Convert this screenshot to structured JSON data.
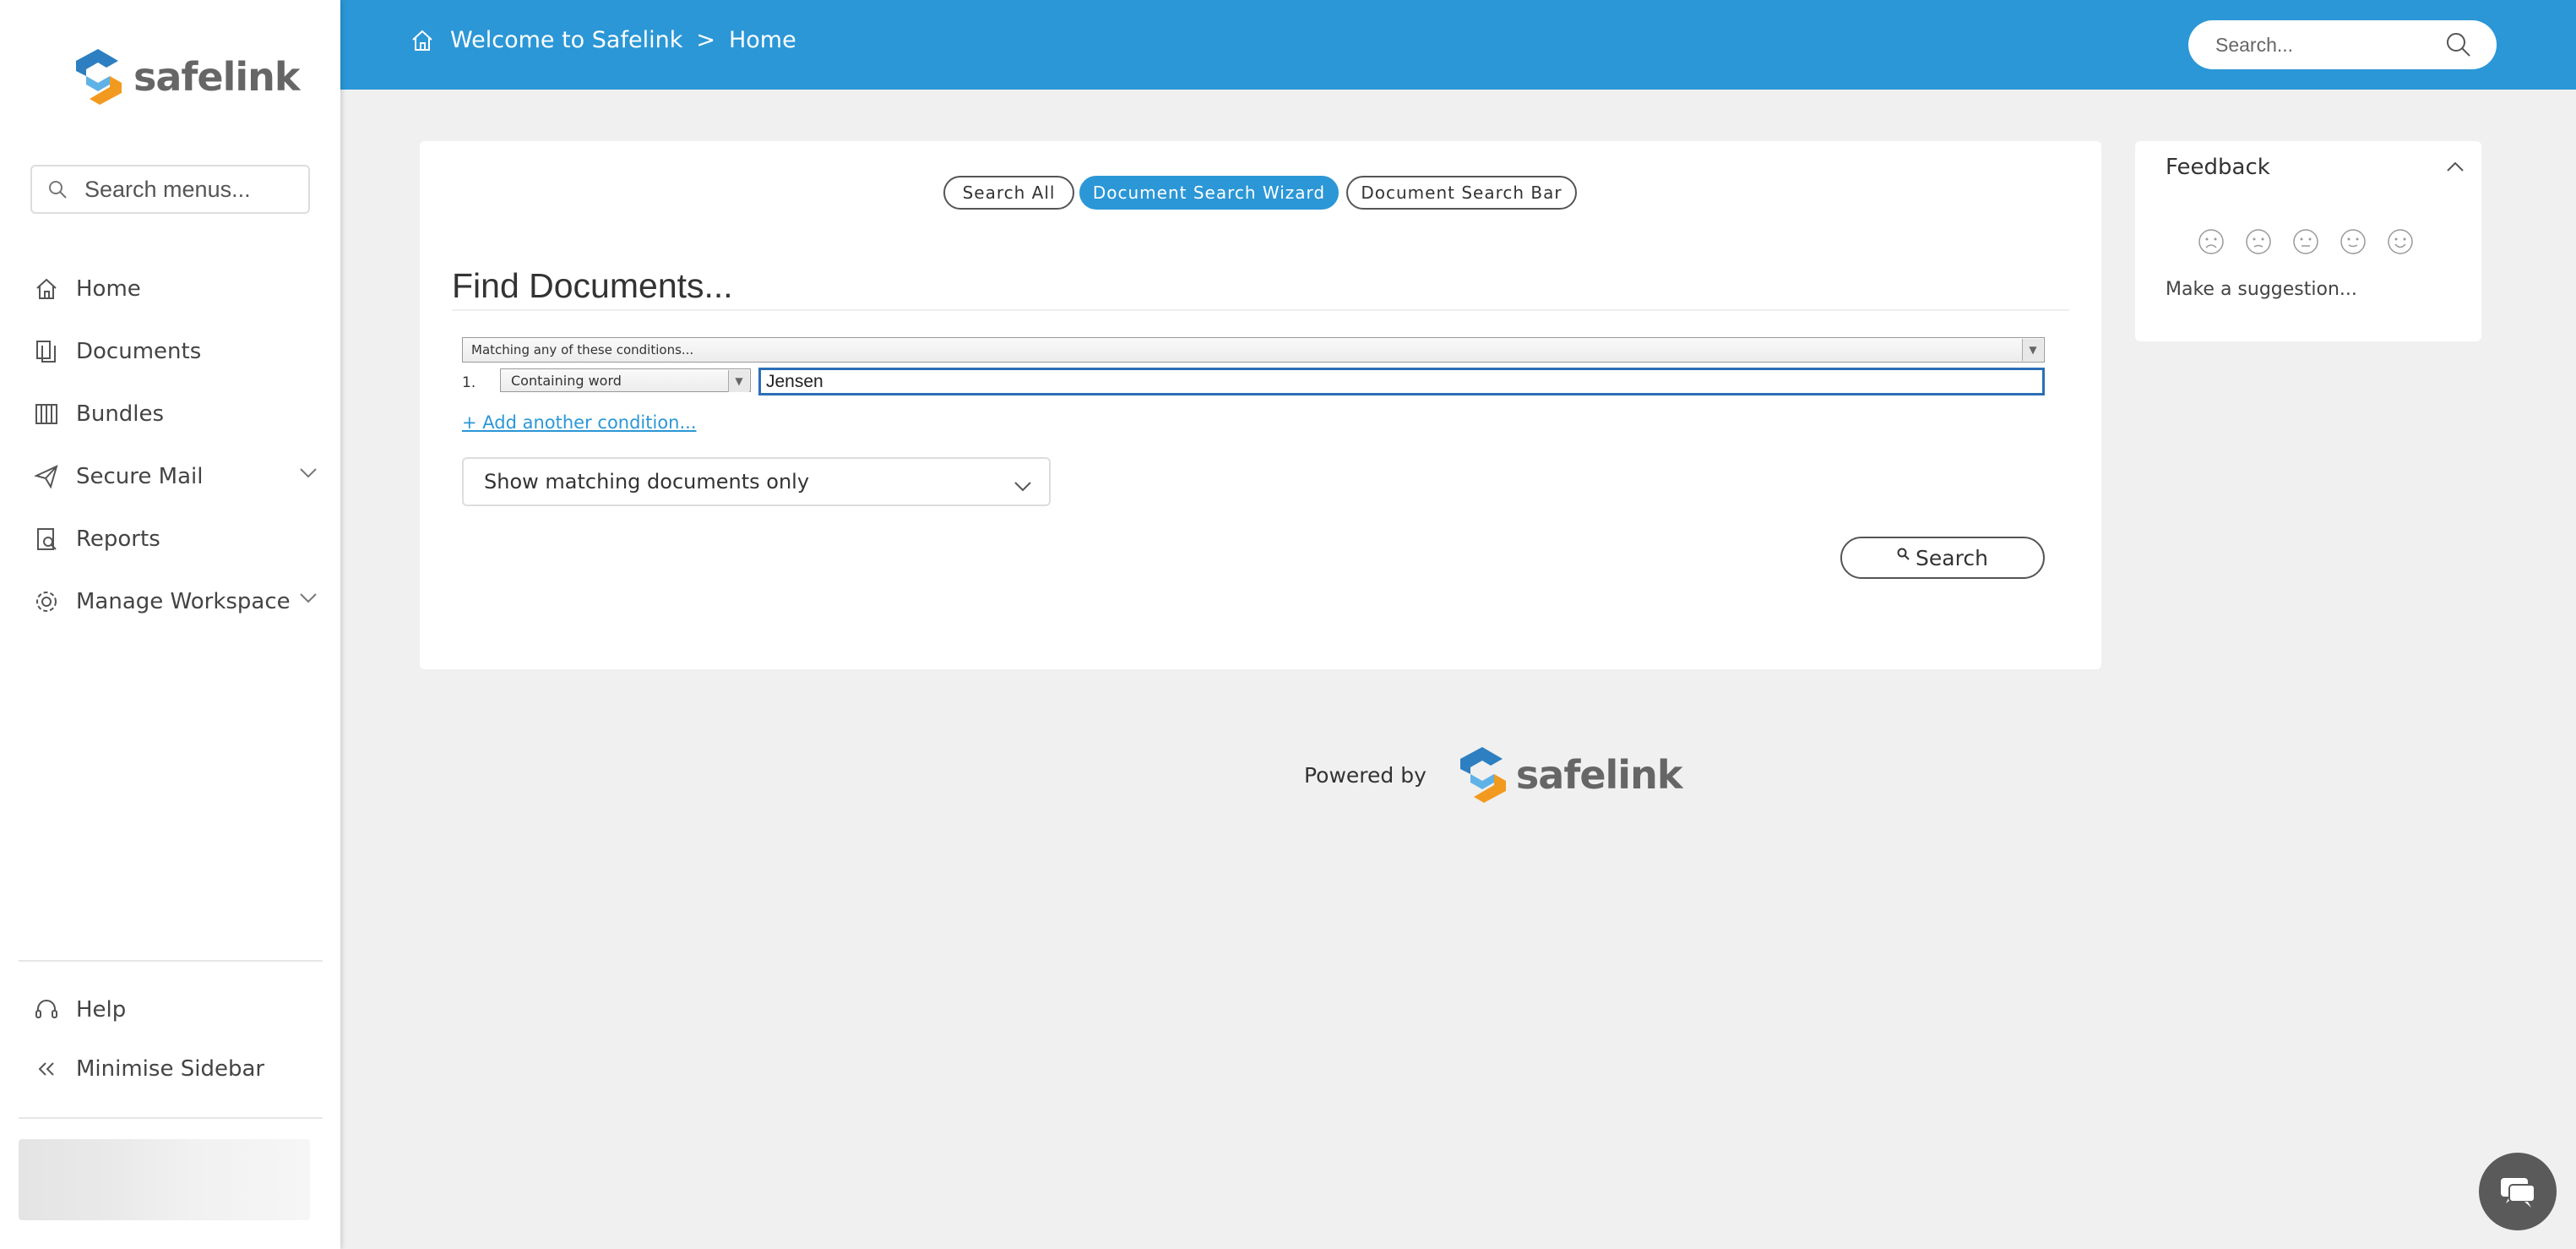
{
  "brand": {
    "name": "safelink",
    "colors": {
      "primary": "#2b97d6",
      "logo_blue": "#2d7fc1",
      "logo_orange": "#f29a1f"
    }
  },
  "sidebar": {
    "search_placeholder": "Search menus...",
    "items": [
      {
        "label": "Home",
        "icon": "home-icon"
      },
      {
        "label": "Documents",
        "icon": "documents-icon"
      },
      {
        "label": "Bundles",
        "icon": "bundles-icon"
      },
      {
        "label": "Secure Mail",
        "icon": "paper-plane-icon",
        "expandable": true
      },
      {
        "label": "Reports",
        "icon": "reports-icon"
      },
      {
        "label": "Manage Workspace",
        "icon": "gear-icon",
        "expandable": true
      }
    ],
    "bottom": [
      {
        "label": "Help",
        "icon": "headset-icon"
      },
      {
        "label": "Minimise Sidebar",
        "icon": "double-chevron-left-icon"
      }
    ]
  },
  "header": {
    "breadcrumb": {
      "root": "Welcome to Safelink",
      "separator": ">",
      "current": "Home"
    },
    "search_placeholder": "Search..."
  },
  "main": {
    "modes": [
      {
        "label": "Search All",
        "active": false
      },
      {
        "label": "Document Search Wizard",
        "active": true
      },
      {
        "label": "Document Search Bar",
        "active": false
      }
    ],
    "title": "Find Documents...",
    "match_mode": "Matching any of these conditions...",
    "conditions": [
      {
        "number": "1.",
        "operator": "Containing word",
        "value": "Jensen"
      }
    ],
    "add_condition": "+ Add another condition...",
    "display_option": "Show matching documents only",
    "search_button": "Search"
  },
  "feedback": {
    "title": "Feedback",
    "faces": [
      "very-sad-face-icon",
      "sad-face-icon",
      "neutral-face-icon",
      "happy-face-icon",
      "very-happy-face-icon"
    ],
    "suggestion": "Make a suggestion..."
  },
  "footer": {
    "powered_by": "Powered by"
  }
}
